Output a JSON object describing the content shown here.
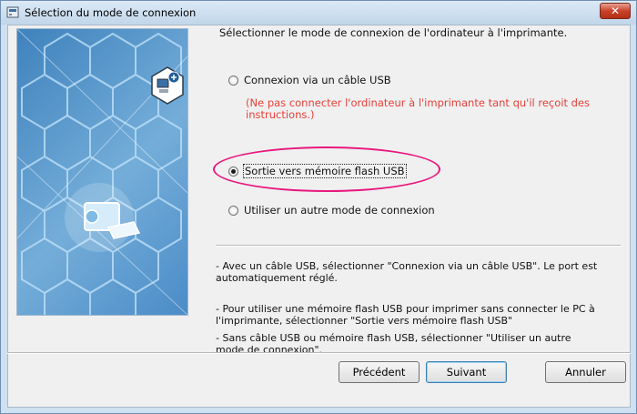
{
  "window": {
    "title": "Sélection du mode de connexion",
    "close_label": "✕"
  },
  "main": {
    "heading": "Sélectionner le mode de connexion de l'ordinateur à l'imprimante.",
    "options": [
      {
        "label": "Connexion via un câble USB",
        "selected": false
      },
      {
        "label": "Sortie vers mémoire flash USB",
        "selected": true
      },
      {
        "label": "Utiliser un autre mode de connexion",
        "selected": false
      }
    ],
    "warning": "(Ne pas connecter l'ordinateur à l'imprimante tant qu'il reçoit des instructions.)",
    "help": [
      "- Avec un câble USB, sélectionner \"Connexion via un câble USB\". Le port est automatiquement réglé.",
      "- Pour utiliser une mémoire flash USB pour imprimer sans connecter le PC à l'imprimante, sélectionner \"Sortie vers mémoire flash USB\"",
      "- Sans câble USB ou mémoire flash USB, sélectionner \"Utiliser un autre mode de connexion\"."
    ]
  },
  "buttons": {
    "back": "Précédent",
    "next": "Suivant",
    "cancel": "Annuler"
  },
  "colors": {
    "warning": "#e8413a",
    "highlight": "#e8187e",
    "banner": "#4b8cc7"
  }
}
